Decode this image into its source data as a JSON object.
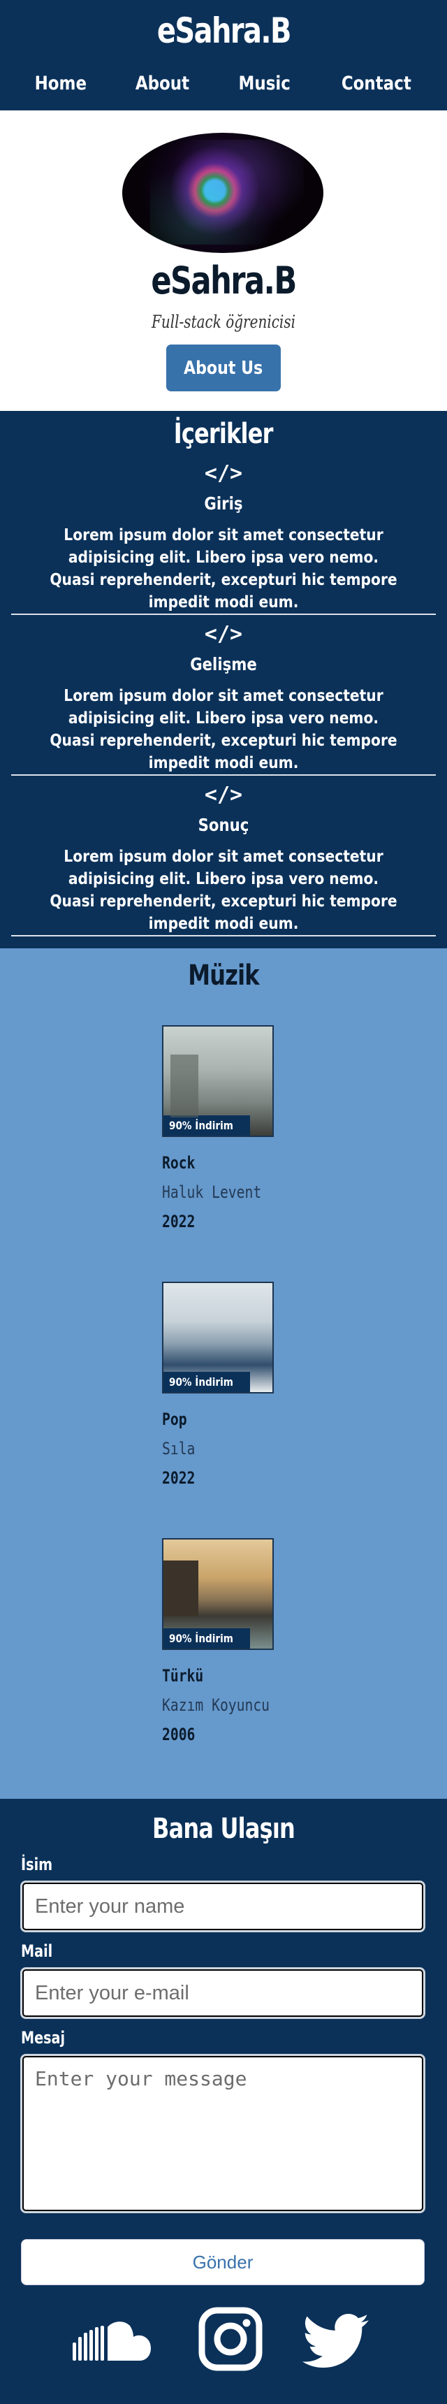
{
  "header": {
    "title": "eSahra.B",
    "nav": [
      "Home",
      "About",
      "Music",
      "Contact"
    ]
  },
  "hero": {
    "name": "eSahra.B",
    "role": "Full-stack öğrenicisi",
    "button": "About Us"
  },
  "contents": {
    "title": "İçerikler",
    "icon": "code-icon",
    "items": [
      {
        "title": "Giriş",
        "text": "Lorem ipsum dolor sit amet consectetur adipisicing elit. Libero ipsa vero nemo. Quasi reprehenderit, excepturi hic tempore impedit modi eum."
      },
      {
        "title": "Gelişme",
        "text": "Lorem ipsum dolor sit amet consectetur adipisicing elit. Libero ipsa vero nemo. Quasi reprehenderit, excepturi hic tempore impedit modi eum."
      },
      {
        "title": "Sonuç",
        "text": "Lorem ipsum dolor sit amet consectetur adipisicing elit. Libero ipsa vero nemo. Quasi reprehenderit, excepturi hic tempore impedit modi eum."
      }
    ]
  },
  "music": {
    "title": "Müzik",
    "albums": [
      {
        "badge": "90% İndirim",
        "genre": "Rock",
        "artist": "Haluk Levent",
        "year": "2022"
      },
      {
        "badge": "90% İndirim",
        "genre": "Pop",
        "artist": "Sıla",
        "year": "2022"
      },
      {
        "badge": "90% İndirim",
        "genre": "Türkü",
        "artist": "Kazım Koyuncu",
        "year": "2006"
      }
    ]
  },
  "contact": {
    "title": "Bana Ulaşın",
    "name_label": "İsim",
    "name_placeholder": "Enter your name",
    "mail_label": "Mail",
    "mail_placeholder": "Enter your e-mail",
    "message_label": "Mesaj",
    "message_placeholder": "Enter your message",
    "send": "Gönder",
    "social": [
      "soundcloud-icon",
      "instagram-icon",
      "twitter-icon"
    ]
  },
  "colors": {
    "navy": "#0b3159",
    "music_bg": "#6699cc",
    "button_blue": "#3872ab",
    "white": "#ffffff"
  }
}
